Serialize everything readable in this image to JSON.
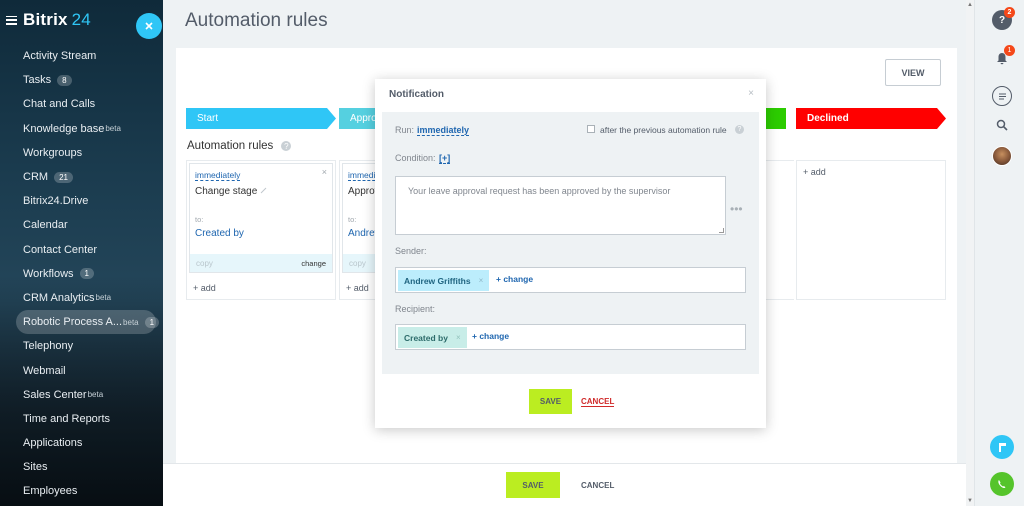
{
  "sidebar": {
    "brand": "Bitrix",
    "brand_num": "24",
    "items": [
      {
        "label": "Activity Stream"
      },
      {
        "label": "Tasks",
        "count": "8"
      },
      {
        "label": "Chat and Calls"
      },
      {
        "label": "Knowledge base",
        "sup": "beta"
      },
      {
        "label": "Workgroups"
      },
      {
        "label": "CRM",
        "count": "21"
      },
      {
        "label": "Bitrix24.Drive"
      },
      {
        "label": "Calendar"
      },
      {
        "label": "Contact Center"
      },
      {
        "label": "Workflows",
        "count": "1"
      },
      {
        "label": "CRM Analytics",
        "sup": "beta"
      },
      {
        "label": "Robotic Process A...",
        "sup": "beta",
        "count": "1"
      },
      {
        "label": "Telephony"
      },
      {
        "label": "Webmail"
      },
      {
        "label": "Sales Center",
        "sup": "beta"
      },
      {
        "label": "Time and Reports"
      },
      {
        "label": "Applications"
      },
      {
        "label": "Sites"
      },
      {
        "label": "Employees"
      }
    ]
  },
  "main": {
    "title": "Automation rules",
    "view_label": "VIEW",
    "stages": {
      "start": "Start",
      "approved": "Appro",
      "declined": "Declined"
    },
    "rules_label": "Automation rules",
    "help": "?",
    "rule_cards": [
      {
        "when": "immediately",
        "title": "Change stage",
        "to": "to:",
        "value": "Created by",
        "copy": "copy",
        "change": "change",
        "close": "×"
      },
      {
        "when": "immedia",
        "title": "Approv",
        "to": "to:",
        "value": "Andrew",
        "copy": "copy"
      }
    ],
    "add_label": "+ add"
  },
  "bottom_bar": {
    "save": "SAVE",
    "cancel": "CANCEL"
  },
  "modal": {
    "title": "Notification",
    "close": "×",
    "run_label": "Run:",
    "run_value": "immediately",
    "after_label": "after the previous automation rule",
    "condition_label": "Condition:",
    "condition_value": "[+]",
    "message_placeholder": "Your leave approval request has been approved by the supervisor",
    "dots": "•••",
    "sender_label": "Sender:",
    "sender_tag": "Andrew Griffiths",
    "recipient_label": "Recipient:",
    "recipient_tag": "Created by",
    "change_label": "+ change",
    "tag_remove": "×",
    "save": "SAVE",
    "cancel": "CANCEL"
  },
  "rightbar": {
    "help_badge": "2",
    "notif_badge": "1"
  },
  "colors": {
    "accent": "#2fc6f6",
    "save_green": "#bbed21",
    "declined_red": "#ff0000",
    "success_green": "#2ccc00",
    "link_blue": "#2067b0"
  }
}
